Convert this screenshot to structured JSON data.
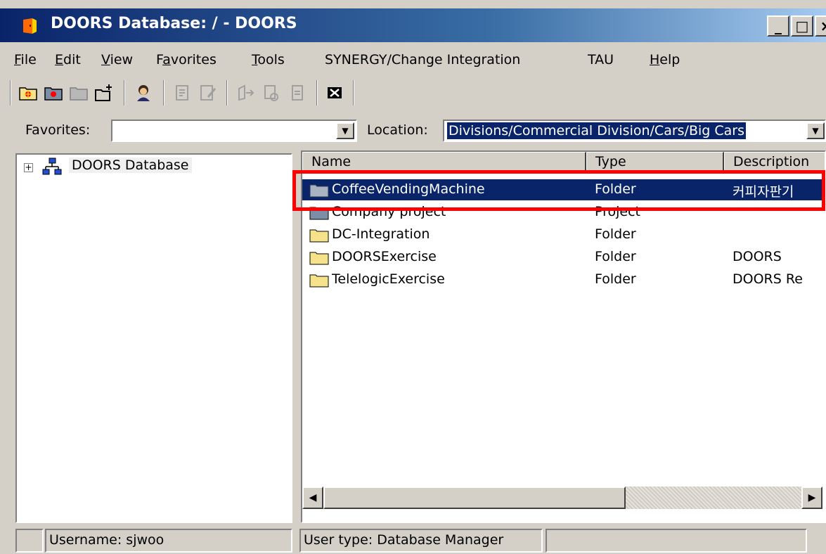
{
  "window": {
    "title": "DOORS Database: / - DOORS",
    "minimize_glyph": "_",
    "maximize_glyph": "□",
    "close_glyph": "×"
  },
  "menu": [
    {
      "prefix": "",
      "mnemonic": "F",
      "suffix": "ile"
    },
    {
      "prefix": "",
      "mnemonic": "E",
      "suffix": "dit"
    },
    {
      "prefix": "",
      "mnemonic": "V",
      "suffix": "iew"
    },
    {
      "prefix": "F",
      "mnemonic": "a",
      "suffix": "vorites"
    },
    {
      "prefix": "",
      "mnemonic": "T",
      "suffix": "ools"
    },
    {
      "prefix": "SYNERGY/Change Integration",
      "mnemonic": "",
      "suffix": ""
    },
    {
      "prefix": "TAU",
      "mnemonic": "",
      "suffix": ""
    },
    {
      "prefix": "",
      "mnemonic": "H",
      "suffix": "elp"
    }
  ],
  "toolbar": {
    "icons": [
      "new-folder-icon",
      "new-project-icon",
      "new-module-icon",
      "new-link-module-icon",
      "user-manager-icon",
      "properties-icon",
      "edit-properties-icon",
      "open-icon",
      "open-read-only-icon",
      "open-share-icon",
      "exit-icon"
    ]
  },
  "address": {
    "favorites_label": "Favorites:",
    "favorites_value": "",
    "location_label": "Location:",
    "location_value": "Divisions/Commercial Division/Cars/Big Cars"
  },
  "tree": {
    "expander": "+",
    "root_label": "DOORS Database"
  },
  "list": {
    "columns": [
      "Name",
      "Type",
      "Description"
    ],
    "rows": [
      {
        "name": "CoffeeVendingMachine",
        "type": "Folder",
        "description": "커피자판기",
        "icon": "folder-gray-icon",
        "selected": true
      },
      {
        "name": "Company project",
        "type": "Project",
        "description": "",
        "icon": "project-icon",
        "selected": false
      },
      {
        "name": "DC-Integration",
        "type": "Folder",
        "description": "",
        "icon": "folder-icon",
        "selected": false
      },
      {
        "name": "DOORSExercise",
        "type": "Folder",
        "description": "DOORS",
        "icon": "folder-icon",
        "selected": false
      },
      {
        "name": "TelelogicExercise",
        "type": "Folder",
        "description": "DOORS Re",
        "icon": "folder-icon",
        "selected": false
      }
    ]
  },
  "status": {
    "username": "Username: sjwoo",
    "usertype": "User type: Database Manager"
  },
  "colors": {
    "selection": "#0a246a",
    "highlight_box": "#ff0000",
    "folder_yellow": "#f5e28a",
    "folder_gray": "#a9b3c2"
  }
}
